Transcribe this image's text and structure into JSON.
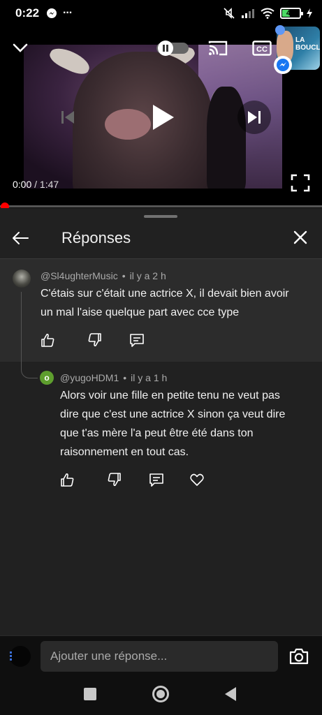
{
  "status_bar": {
    "time": "0:22",
    "more": "···",
    "battery_level": "43",
    "battery_fraction": 0.43,
    "icons": [
      "messenger-icon",
      "more-icon",
      "mute-icon",
      "signal-icon",
      "wifi-icon",
      "battery-icon",
      "charging-icon"
    ]
  },
  "player": {
    "current_time": "0:00",
    "separator": "/",
    "duration": "1:47",
    "progress_fraction": 0.0,
    "pip_text": "LA BOUCLE",
    "icons": [
      "collapse-chevron-icon",
      "pause-toggle-icon",
      "cast-icon",
      "captions-icon",
      "settings-gear-icon",
      "previous-icon",
      "play-icon",
      "next-icon",
      "fullscreen-icon"
    ],
    "accent_color": "#ff0000"
  },
  "replies_sheet": {
    "title": "Réponses",
    "parent_comment": {
      "author": "@Sl4ughterMusic",
      "time": "il y a 2 h",
      "text": "C'étais sur c'était une actrice X, il devait bien avoir un mal l'aise quelque part avec cce type"
    },
    "reply": {
      "avatar_letter": "o",
      "avatar_color": "#5e9e2e",
      "author": "@yugoHDM1",
      "time": "il y a 1 h",
      "text": "Alors voir une fille en petite tenu ne veut pas dire que c'est une actrice X sinon ça veut dire que t'as mère l'a peut être été dans ton raisonnement en tout cas."
    }
  },
  "composer": {
    "placeholder": "Ajouter une réponse..."
  }
}
